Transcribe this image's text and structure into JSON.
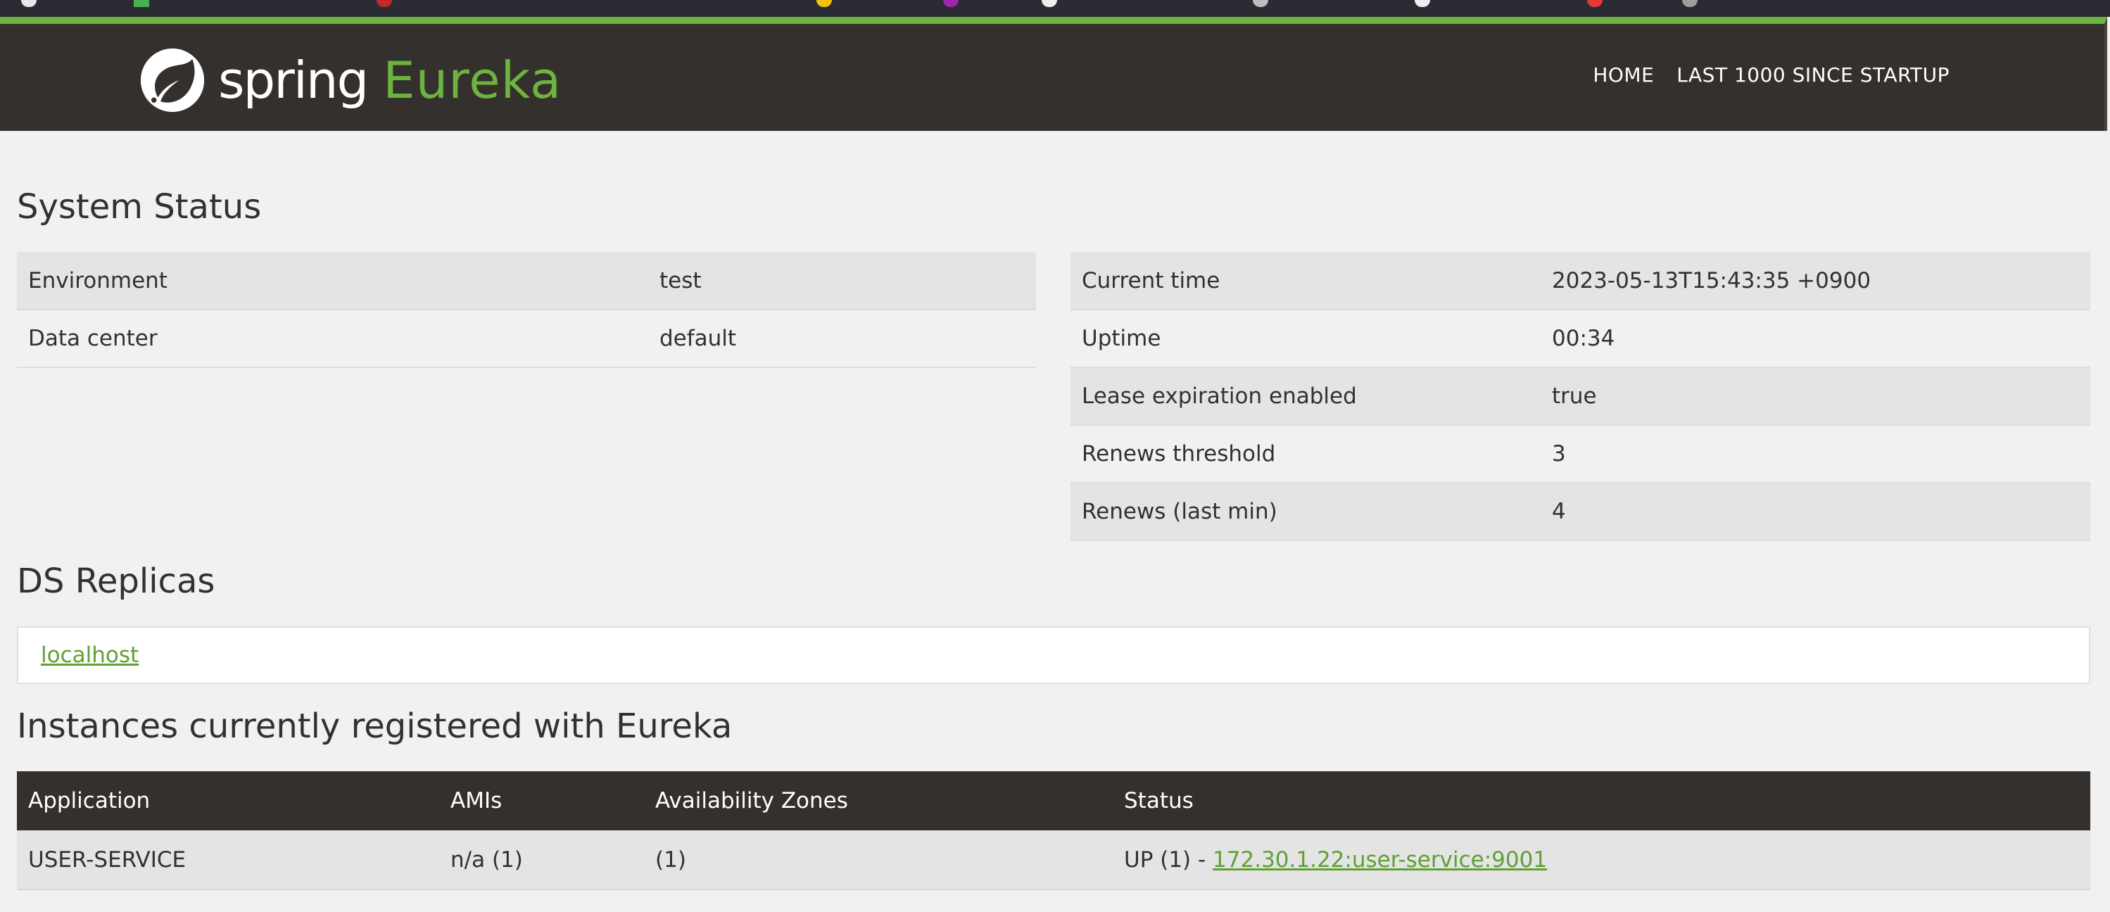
{
  "brand": {
    "spring": "spring",
    "eureka": "Eureka",
    "logo_icon": "spring-leaf-icon",
    "accent_color": "#6db33f",
    "navbar_color": "#34302d"
  },
  "nav": {
    "home": "HOME",
    "last1000": "LAST 1000 SINCE STARTUP"
  },
  "system_status": {
    "title": "System Status",
    "left": [
      {
        "key": "Environment",
        "value": "test"
      },
      {
        "key": "Data center",
        "value": "default"
      }
    ],
    "right": [
      {
        "key": "Current time",
        "value": "2023-05-13T15:43:35 +0900"
      },
      {
        "key": "Uptime",
        "value": "00:34"
      },
      {
        "key": "Lease expiration enabled",
        "value": "true"
      },
      {
        "key": "Renews threshold",
        "value": "3"
      },
      {
        "key": "Renews (last min)",
        "value": "4"
      }
    ]
  },
  "ds_replicas": {
    "title": "DS Replicas",
    "items": [
      "localhost"
    ]
  },
  "instances": {
    "title": "Instances currently registered with Eureka",
    "headers": [
      "Application",
      "AMIs",
      "Availability Zones",
      "Status"
    ],
    "rows": [
      {
        "application": "USER-SERVICE",
        "amis": "n/a (1)",
        "zones": "(1)",
        "status_prefix": "UP (1) - ",
        "status_link": "172.30.1.22:user-service:9001"
      }
    ]
  }
}
